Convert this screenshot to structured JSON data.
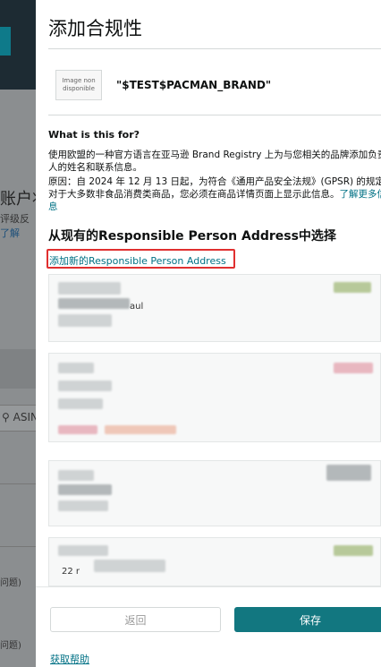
{
  "background": {
    "title_fragment": "账户状",
    "sub_line1": "评级反",
    "sub_line2_link": "了解",
    "search_fragment": "ASIN",
    "small_fragment1": "问题)",
    "small_fragment2": "问题)"
  },
  "modal": {
    "title": "添加合规性",
    "brand": {
      "image_placeholder_line1": "Image non",
      "image_placeholder_line2": "disponible",
      "name": "\"$TEST$PACMAN_BRAND\""
    },
    "info": {
      "heading": "What is this for?",
      "line1": "使用欧盟的一种官方语言在亚马逊 Brand Registry 上为与您相关的品牌添加负责",
      "line2": "人的姓名和联系信息。",
      "line3": "原因：自 2024 年 12 月 13 日起，为符合《通用产品安全法规》(GPSR) 的规定，",
      "line4_text": "对于大多数非食品消费类商品，您必须在商品详情页面上显示此信息。",
      "line4_link": "了解更多信",
      "line5_link": "息"
    },
    "section_title": "从现有的Responsible Person Address中选择",
    "add_link": "添加新的Responsible Person Address",
    "cards": [
      {
        "visible_text": "aul"
      },
      {
        "visible_text": ""
      },
      {
        "visible_text": ""
      },
      {
        "visible_text": "22 r"
      }
    ],
    "footer": {
      "back_label": "返回",
      "save_label": "保存",
      "help_link": "获取帮助"
    }
  },
  "colors": {
    "primary": "#127780",
    "link": "#007185",
    "highlight_border": "#e03030"
  }
}
